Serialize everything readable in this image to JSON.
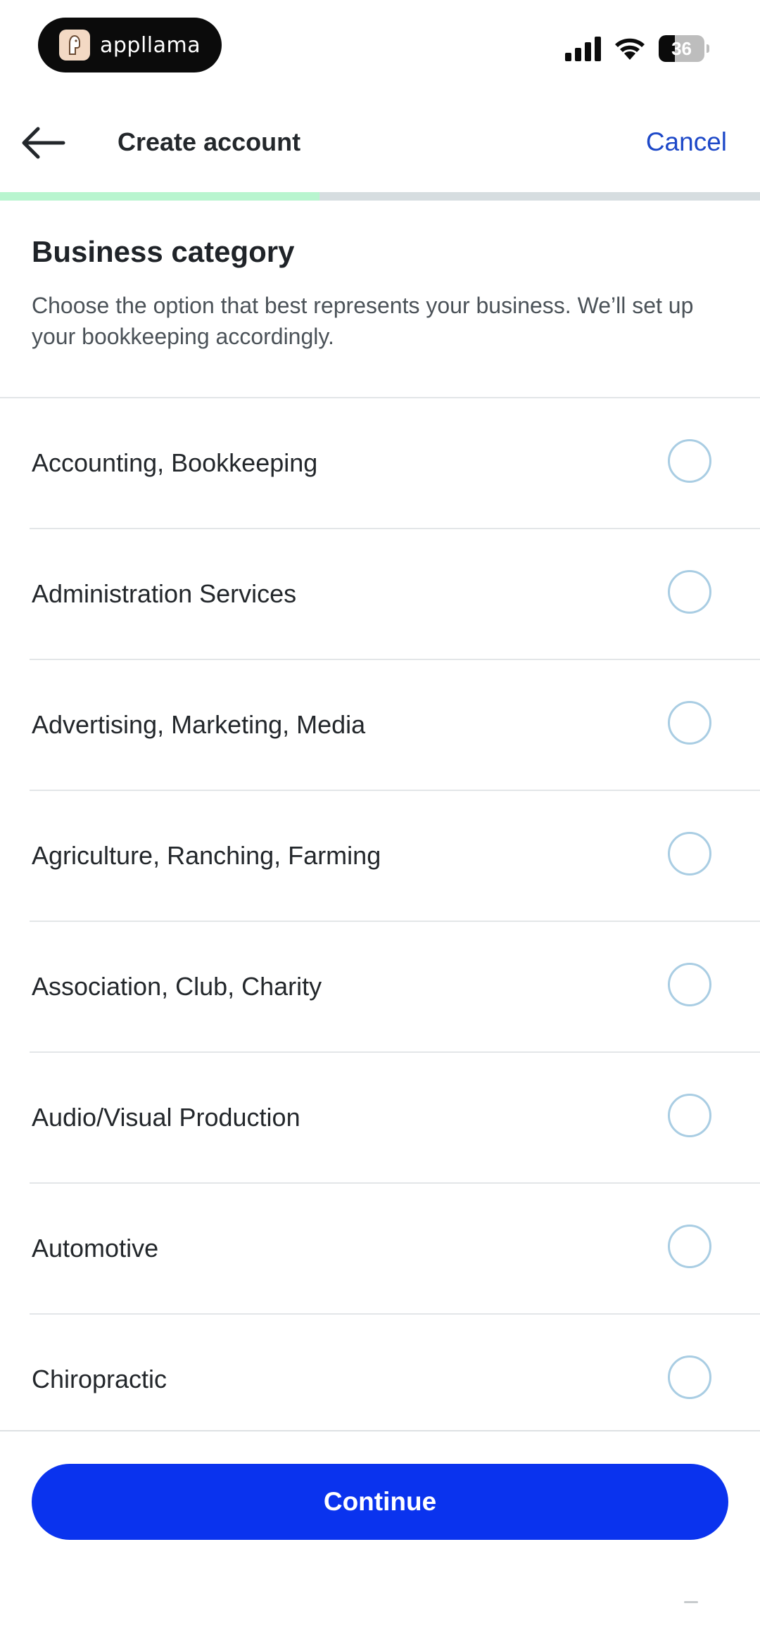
{
  "status_bar": {
    "brand_name": "appllama",
    "battery_level": "36",
    "battery_percent": 36
  },
  "header": {
    "title": "Create account",
    "cancel_label": "Cancel"
  },
  "progress": {
    "fraction": 0.42
  },
  "section": {
    "title": "Business category",
    "description": "Choose the option that best represents your business. We’ll set up your bookkeeping accordingly."
  },
  "options": [
    {
      "label": "Accounting, Bookkeeping",
      "selected": false
    },
    {
      "label": "Administration Services",
      "selected": false
    },
    {
      "label": "Advertising, Marketing, Media",
      "selected": false
    },
    {
      "label": "Agriculture, Ranching, Farming",
      "selected": false
    },
    {
      "label": "Association, Club, Charity",
      "selected": false
    },
    {
      "label": "Audio/Visual Production",
      "selected": false
    },
    {
      "label": "Automotive",
      "selected": false
    },
    {
      "label": "Chiropractic",
      "selected": false
    }
  ],
  "footer": {
    "continue_label": "Continue"
  },
  "colors": {
    "accent": "#0a33ee",
    "link": "#1d48c8",
    "progress": "#b8f5cf",
    "radio_border": "#a9cde3"
  },
  "icons": {
    "back": "arrow-left-icon",
    "signal": "cellular-signal-icon",
    "wifi": "wifi-icon",
    "battery": "battery-icon",
    "brand": "llama-logo-icon"
  }
}
